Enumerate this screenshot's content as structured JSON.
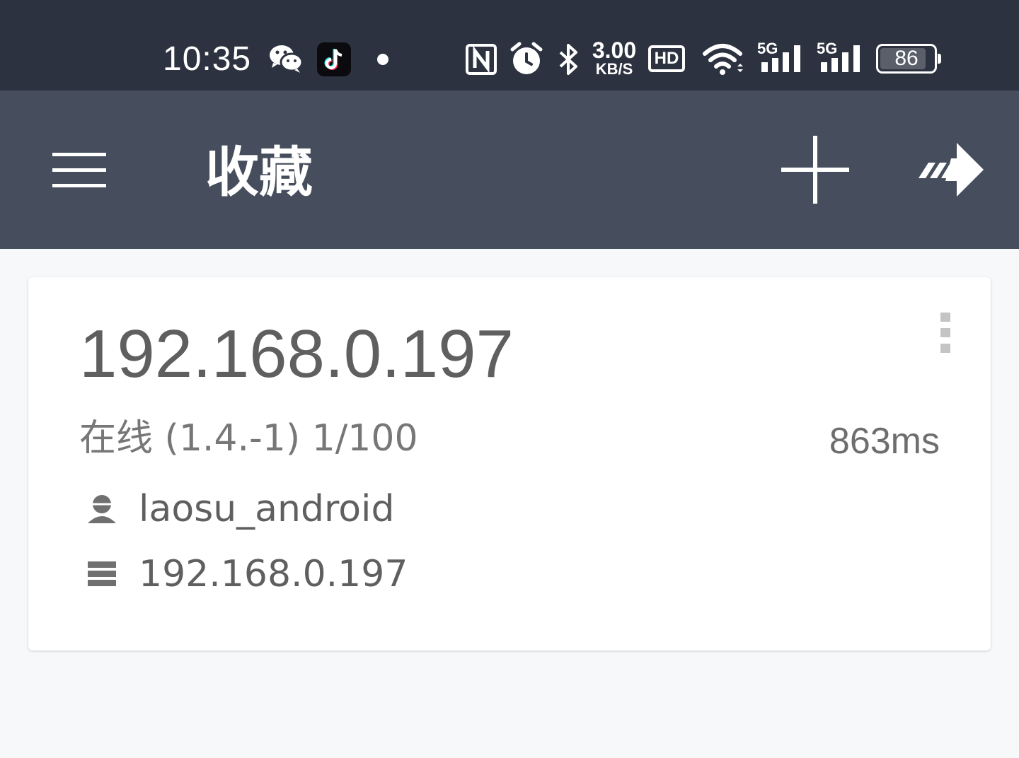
{
  "status_bar": {
    "time": "10:35",
    "net_speed_value": "3.00",
    "net_speed_unit": "KB/S",
    "hd_label": "HD",
    "signal_1_label": "5G",
    "signal_2_label": "5G",
    "battery_level": "86",
    "icons": [
      "wechat-icon",
      "tiktok-icon",
      "notification-dot-icon",
      "nfc-icon",
      "alarm-icon",
      "bluetooth-icon",
      "hd-voice-icon",
      "wifi-icon",
      "signal-5g-icon",
      "signal-5g-icon",
      "battery-icon"
    ]
  },
  "app_bar": {
    "title": "收藏",
    "icons": [
      "menu-icon",
      "add-icon",
      "connect-arrow-icon"
    ],
    "background": "#464e5e"
  },
  "favorites": [
    {
      "title": "192.168.0.197",
      "status": "在线 (1.4.-1)  1/100",
      "latency": "863ms",
      "username": "laosu_android",
      "host": "192.168.0.197"
    }
  ],
  "colors": {
    "status_bar": "#2c323f",
    "page_background": "#f7f8fa",
    "card_text": "#5f5f5f"
  }
}
